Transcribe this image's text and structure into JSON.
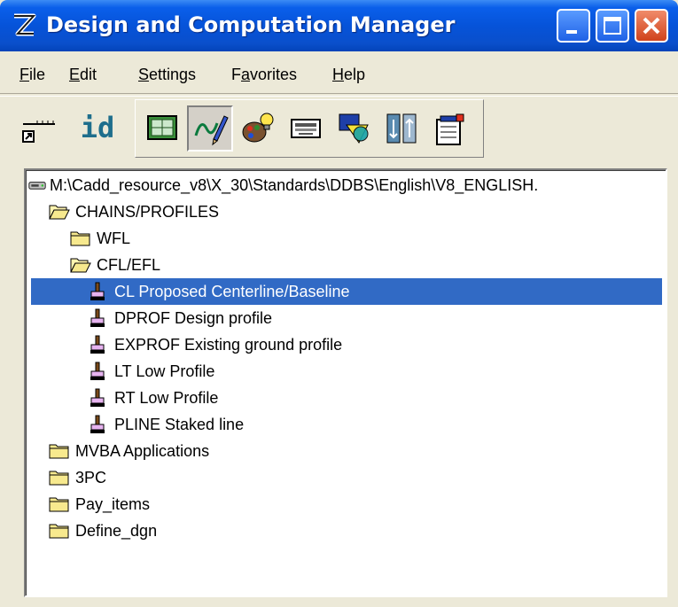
{
  "window": {
    "title": "Design and Computation Manager",
    "title_bar_color": "#0A5FEA",
    "selection_color": "#316AC5"
  },
  "menu": [
    {
      "label": "File",
      "mnemonic": "F",
      "rest": "ile"
    },
    {
      "label": "Edit",
      "mnemonic": "E",
      "rest": "dit"
    },
    {
      "label": "Settings",
      "mnemonic": "S",
      "rest": "ettings"
    },
    {
      "label": "Favorites",
      "pre": "F",
      "mnemonic": "a",
      "rest": "vorites"
    },
    {
      "label": "Help",
      "mnemonic": "H",
      "rest": "elp"
    }
  ],
  "toolbar": {
    "id_label": "id",
    "buttons": [
      "ruler-icon",
      "id-icon",
      "graphics-panel-icon",
      "draw-icon",
      "palette-icon",
      "keyboard-icon",
      "shapes-icon",
      "split-icon",
      "properties-icon"
    ]
  },
  "tree": {
    "root_label": "M:\\Cadd_resource_v8\\X_30\\Standards\\DDBS\\English\\V8_ENGLISH.",
    "items": [
      {
        "label": "CHAINS/PROFILES",
        "icon": "folder-open-icon"
      },
      {
        "label": "WFL",
        "icon": "folder-icon"
      },
      {
        "label": "CFL/EFL",
        "icon": "folder-open-icon"
      },
      {
        "label": "CL Proposed Centerline/Baseline",
        "icon": "item-icon",
        "selected": true
      },
      {
        "label": "DPROF Design profile",
        "icon": "item-icon"
      },
      {
        "label": "EXPROF Existing ground profile",
        "icon": "item-icon"
      },
      {
        "label": "LT Low Profile",
        "icon": "item-icon"
      },
      {
        "label": "RT Low Profile",
        "icon": "item-icon"
      },
      {
        "label": "PLINE Staked line",
        "icon": "item-icon"
      },
      {
        "label": "MVBA Applications",
        "icon": "folder-icon"
      },
      {
        "label": "3PC",
        "icon": "folder-icon"
      },
      {
        "label": "Pay_items",
        "icon": "folder-icon"
      },
      {
        "label": "Define_dgn",
        "icon": "folder-icon"
      }
    ]
  }
}
